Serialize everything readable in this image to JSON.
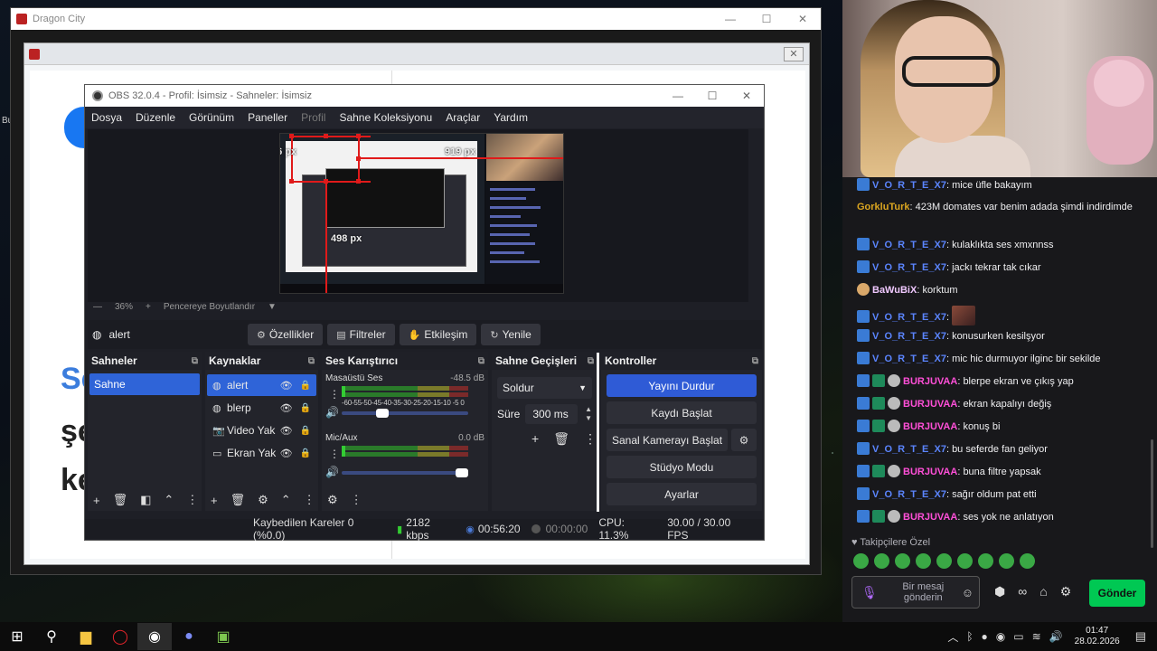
{
  "dragon_city": {
    "title": "Dragon City",
    "page_text_1": "Se",
    "page_text_2": "şe",
    "page_text_3": "ke",
    "left_edge_text": "Bu"
  },
  "obs": {
    "title": "OBS 32.0.4 - Profil: İsimsiz - Sahneler: İsimsiz",
    "menu": [
      "Dosya",
      "Düzenle",
      "Görünüm",
      "Paneller",
      "Profil",
      "Sahne Koleksiyonu",
      "Araçlar",
      "Yardım"
    ],
    "preview": {
      "label_left": "66 px",
      "label_right": "919 px",
      "label_mid": "498 px",
      "zoom": "36%",
      "fit_label": "Pencereye Boyutlandır"
    },
    "source_toolbar": {
      "source_name": "alert",
      "properties": "Özellikler",
      "filters": "Filtreler",
      "interact": "Etkileşim",
      "refresh": "Yenile"
    },
    "scenes": {
      "title": "Sahneler",
      "items": [
        "Sahne"
      ]
    },
    "sources": {
      "title": "Kaynaklar",
      "items": [
        {
          "name": "alert",
          "icon": "browser-icon"
        },
        {
          "name": "blerp",
          "icon": "browser-icon"
        },
        {
          "name": "Video Yak",
          "icon": "camera-icon"
        },
        {
          "name": "Ekran Yak",
          "icon": "monitor-icon"
        }
      ]
    },
    "mixer": {
      "title": "Ses Karıştırıcı",
      "channels": [
        {
          "name": "Masaüstü Ses",
          "db": "-48.5 dB",
          "level": 0.3
        },
        {
          "name": "Mic/Aux",
          "db": "0.0 dB",
          "level": 1.0
        }
      ],
      "scale": "-60-55-50-45-40-35-30-25-20-15-10 -5 0"
    },
    "transitions": {
      "title": "Sahne Geçişleri",
      "selected": "Soldur",
      "duration_label": "Süre",
      "duration_value": "300 ms"
    },
    "controls": {
      "title": "Kontroller",
      "stop_stream": "Yayını Durdur",
      "start_record": "Kaydı Başlat",
      "start_virtualcam": "Sanal Kamerayı Başlat",
      "studio_mode": "Stüdyo Modu",
      "settings": "Ayarlar"
    },
    "status": {
      "dropped": "Kaybedilen Kareler 0 (%0.0)",
      "bitrate": "2182 kbps",
      "live_time": "00:56:20",
      "rec_time": "00:00:00",
      "cpu": "CPU: 11.3%",
      "fps": "30.00 / 30.00 FPS"
    }
  },
  "chat": {
    "messages": [
      {
        "badges": [
          "b-blue"
        ],
        "user": "V_O_R_T_E_X7",
        "ucls": "u-vortex",
        "text": "mice üfle bakayım"
      },
      {
        "badges": [],
        "user": "GorkluTurk",
        "ucls": "u-gork",
        "text": "423M domates var benim adada şimdi indirdimde"
      },
      {
        "badges": [
          "b-blue"
        ],
        "user": "V_O_R_T_E_X7",
        "ucls": "u-vortex",
        "text": "kulaklıkta ses xmxnnss"
      },
      {
        "badges": [
          "b-blue"
        ],
        "user": "V_O_R_T_E_X7",
        "ucls": "u-vortex",
        "text": "jackı tekrar tak cıkar"
      },
      {
        "badges": [
          "b-vip"
        ],
        "user": "BaWuBiX",
        "ucls": "u-bawu",
        "text": "korktum"
      },
      {
        "badges": [
          "b-blue"
        ],
        "user": "V_O_R_T_E_X7",
        "ucls": "u-vortex",
        "text": ""
      },
      {
        "badges": [
          "b-blue"
        ],
        "user": "V_O_R_T_E_X7",
        "ucls": "u-vortex",
        "text": "konusurken kesilşyor"
      },
      {
        "badges": [
          "b-blue"
        ],
        "user": "V_O_R_T_E_X7",
        "ucls": "u-vortex",
        "text": "mic hic durmuyor ilginc bir sekilde"
      },
      {
        "badges": [
          "b-blue",
          "b-green",
          "b-hp"
        ],
        "user": "BURJUVAA",
        "ucls": "u-burj",
        "text": "blerpe ekran ve çıkış yap"
      },
      {
        "badges": [
          "b-blue",
          "b-green",
          "b-hp"
        ],
        "user": "BURJUVAA",
        "ucls": "u-burj",
        "text": "ekran kapalıyı değiş"
      },
      {
        "badges": [
          "b-blue",
          "b-green",
          "b-hp"
        ],
        "user": "BURJUVAA",
        "ucls": "u-burj",
        "text": "konuş bi"
      },
      {
        "badges": [
          "b-blue"
        ],
        "user": "V_O_R_T_E_X7",
        "ucls": "u-vortex",
        "text": "bu seferde fan geliyor"
      },
      {
        "badges": [
          "b-blue",
          "b-green",
          "b-hp"
        ],
        "user": "BURJUVAA",
        "ucls": "u-burj",
        "text": "buna filtre yapsak"
      },
      {
        "badges": [
          "b-blue"
        ],
        "user": "V_O_R_T_E_X7",
        "ucls": "u-vortex",
        "text": "sağır oldum pat etti"
      },
      {
        "badges": [
          "b-blue",
          "b-green",
          "b-hp"
        ],
        "user": "BURJUVAA",
        "ucls": "u-burj",
        "text": "ses yok ne anlatıyon"
      }
    ],
    "follower_emotes_label": "Takipçilere Özel",
    "input_placeholder": "Bir mesaj gönderin",
    "send_label": "Gönder"
  },
  "taskbar": {
    "time": "01:47",
    "date": "28.02.2026"
  }
}
